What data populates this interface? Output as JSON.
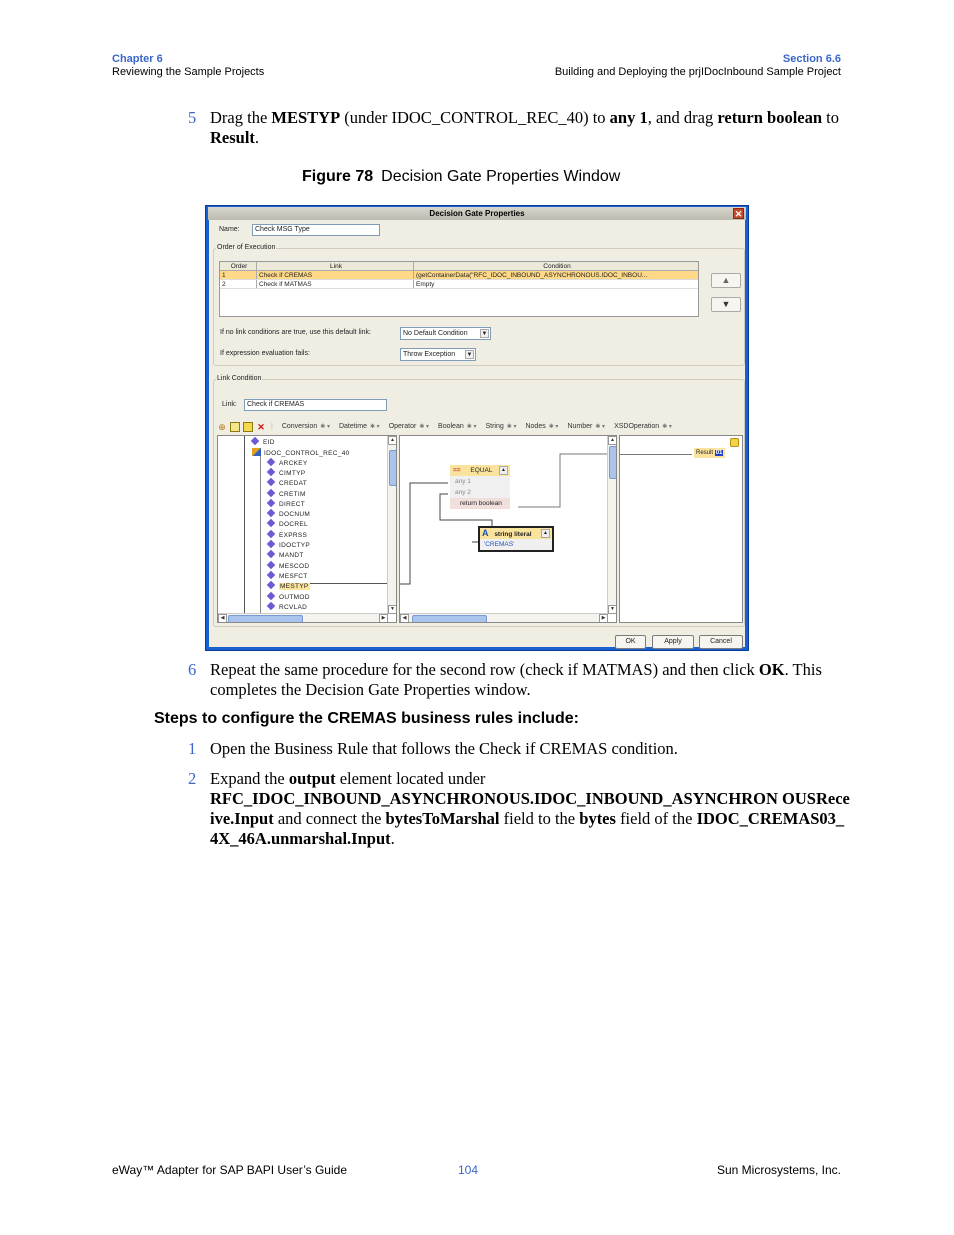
{
  "header": {
    "chapter_label": "Chapter 6",
    "chapter_title": "Reviewing the Sample Projects",
    "section_label": "Section 6.6",
    "section_title": "Building and Deploying the prjIDocInbound Sample Project"
  },
  "step5": {
    "num": "5",
    "parts": [
      "Drag the ",
      "MESTYP",
      " (under IDOC_CONTROL_REC_40) to ",
      "any 1",
      ", and drag ",
      "return boolean",
      " to ",
      "Result",
      "."
    ]
  },
  "figure": {
    "label": "Figure 78",
    "title": "Decision Gate Properties Window"
  },
  "dialog": {
    "title": "Decision Gate Properties",
    "close_icon": "close-icon",
    "name_label": "Name:",
    "name_value": "Check MSG Type",
    "order_group_label": "Order of Execution",
    "table": {
      "columns": [
        "Order",
        "Link",
        "Condition"
      ],
      "rows": [
        {
          "order": "1",
          "link": "Check if CREMAS",
          "condition": "(getContainerData(\"RFC_IDOC_INBOUND_ASYNCHRONOUS.IDOC_INBOU...",
          "selected": true
        },
        {
          "order": "2",
          "link": "Check if MATMAS",
          "condition": "Empty",
          "selected": false
        }
      ]
    },
    "move_up_icon": "arrow-up-icon",
    "move_down_icon": "arrow-down-icon",
    "default_link_label": "If no link conditions are true, use this default link:",
    "default_link_value": "No Default Condition",
    "eval_fail_label": "If expression evaluation fails:",
    "eval_fail_value": "Throw Exception",
    "link_condition_group_label": "Link Condition",
    "link_label": "Link:",
    "link_value": "Check if CREMAS",
    "toolbar_menus": [
      "Conversion",
      "Datetime",
      "Operator",
      "Boolean",
      "String",
      "Nodes",
      "Number",
      "XSDOperation"
    ],
    "tree": {
      "items": [
        "EID",
        "IDOC_CONTROL_REC_40",
        "ARCKEY",
        "CIMTYP",
        "CREDAT",
        "CRETIM",
        "DIRECT",
        "DOCNUM",
        "DOCREL",
        "EXPRSS",
        "IDOCTYP",
        "MANDT",
        "MESCOD",
        "MESFCT",
        "MESTYP",
        "OUTMOD",
        "RCVLAD"
      ],
      "selected": "MESTYP"
    },
    "equal_node": {
      "title": "EQUAL",
      "symbol": "==",
      "inputs": [
        "any 1",
        "any 2"
      ],
      "output": "return boolean"
    },
    "string_literal_node": {
      "title": "string literal",
      "value": "'CREMAS'"
    },
    "result_node": {
      "label": "Result",
      "badge": "01"
    },
    "buttons": {
      "ok": "OK",
      "apply": "Apply",
      "cancel": "Cancel"
    }
  },
  "step6": {
    "num": "6",
    "parts": [
      "Repeat the same procedure for the second row (check if MATMAS) and then click ",
      "OK",
      ". This completes the Decision Gate Properties window."
    ]
  },
  "subheading": "Steps to configure the CREMAS business rules include:",
  "cremas_steps": [
    {
      "num": "1",
      "text": "Open the Business Rule that follows the Check if CREMAS condition."
    },
    {
      "num": "2",
      "parts": [
        "Expand the ",
        "output",
        " element located under ",
        "RFC_IDOC_INBOUND_ASYNCHRONOUS.IDOC_INBOUND_ASYNCHRON OUSReceive.Input",
        " and connect the ",
        "bytesToMarshal",
        " field to the ",
        "bytes",
        " field of the ",
        "IDOC_CREMAS03_4X_46A.unmarshal.Input",
        "."
      ]
    }
  ],
  "footer": {
    "left": "eWay™ Adapter for SAP BAPI User’s Guide",
    "page": "104",
    "right": "Sun Microsystems, Inc."
  }
}
